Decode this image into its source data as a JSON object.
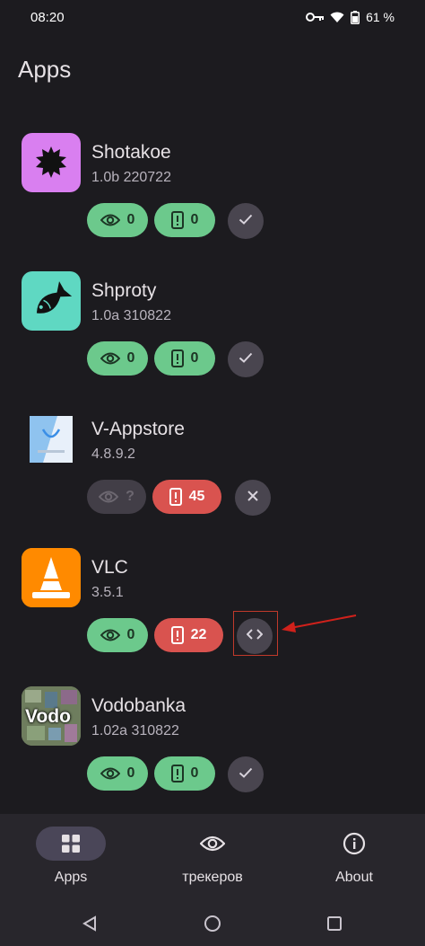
{
  "status_bar": {
    "time": "08:20",
    "battery_text": "61 %"
  },
  "page": {
    "title": "Apps"
  },
  "apps": [
    {
      "name": "Shotakoe",
      "version": "1.0b 220722",
      "trackers_count": "0",
      "permissions_count": "0",
      "action_icon": "check-icon",
      "icon_color": "#d97ff0"
    },
    {
      "name": "Shproty",
      "version": "1.0a 310822",
      "trackers_count": "0",
      "permissions_count": "0",
      "action_icon": "check-icon",
      "icon_color": "#5fd8c2"
    },
    {
      "name": "V-Appstore",
      "version": "4.8.9.2",
      "trackers_count": "?",
      "permissions_count": "45",
      "action_icon": "close-icon",
      "icon_color": "#e8f0fa"
    },
    {
      "name": "VLC",
      "version": "3.5.1",
      "trackers_count": "0",
      "permissions_count": "22",
      "action_icon": "code-icon",
      "icon_color": "#ff8c00"
    },
    {
      "name": "Vodobanka",
      "version": "1.02a 310822",
      "trackers_count": "0",
      "permissions_count": "0",
      "action_icon": "check-icon",
      "icon_color": "#7a8a6a",
      "icon_text": "Vodo"
    }
  ],
  "bottom_nav": {
    "items": [
      {
        "label": "Apps",
        "icon": "grid-icon"
      },
      {
        "label": "трекеров",
        "icon": "eye-icon"
      },
      {
        "label": "About",
        "icon": "info-icon"
      }
    ]
  },
  "colors": {
    "green_chip": "#6cc98c",
    "red_chip": "#d9534f",
    "background": "#1c1b1f"
  }
}
